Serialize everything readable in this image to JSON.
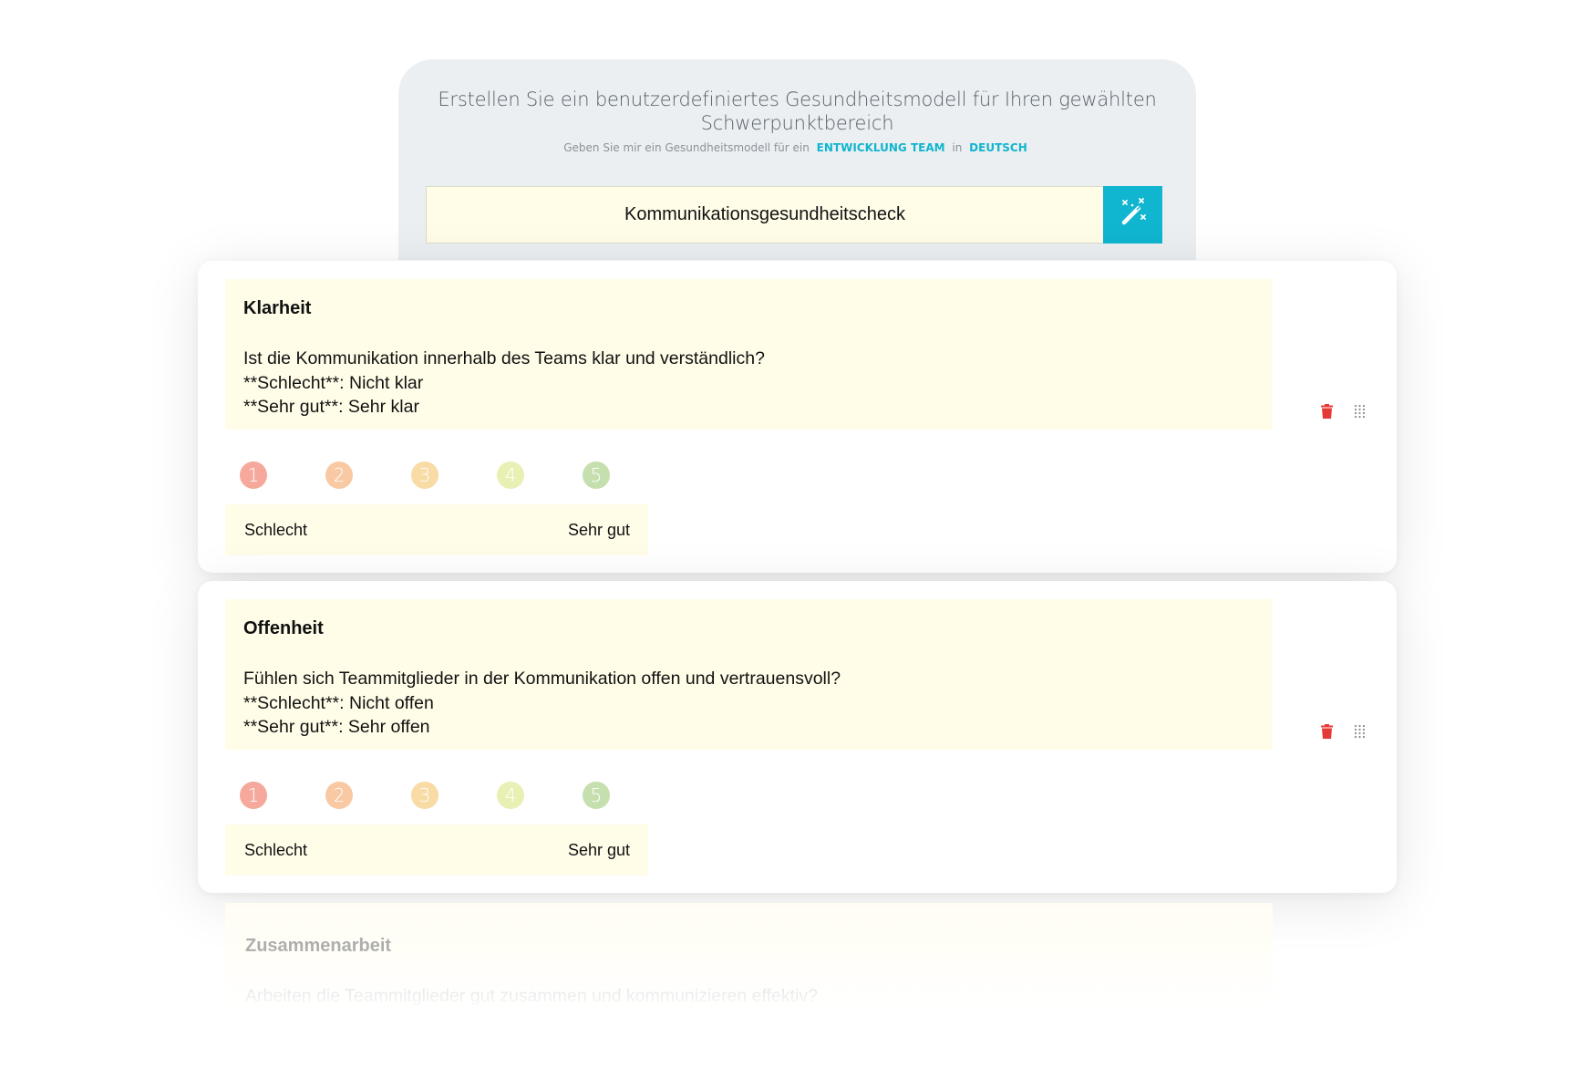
{
  "generator": {
    "title_line1": "Erstellen Sie ein benutzerdefiniertes Gesundheitsmodell für Ihren gewählten",
    "title_line2": "Schwerpunktbereich",
    "subtitle_prefix": "Geben Sie mir ein Gesundheitsmodell für ein",
    "focus_select": "ENTWICKLUNG TEAM",
    "connector": "in",
    "language_select": "DEUTSCH",
    "input_value": "Kommunikationsgesundheitscheck",
    "generate_icon": "magic-wand-icon",
    "accent_color": "#10b5cf"
  },
  "questions": [
    {
      "title": "Klarheit",
      "question": "Ist die Kommunikation innerhalb des Teams klar und verständlich?",
      "bad_line": "**Schlecht**: Nicht klar",
      "good_line": "**Sehr gut**: Sehr klar",
      "scale": [
        "1",
        "2",
        "3",
        "4",
        "5"
      ],
      "low_label": "Schlecht",
      "high_label": "Sehr gut"
    },
    {
      "title": "Offenheit",
      "question": "Fühlen sich Teammitglieder in der Kommunikation offen und vertrauensvoll?",
      "bad_line": "**Schlecht**: Nicht offen",
      "good_line": "**Sehr gut**: Sehr offen",
      "scale": [
        "1",
        "2",
        "3",
        "4",
        "5"
      ],
      "low_label": "Schlecht",
      "high_label": "Sehr gut"
    },
    {
      "title": "Zusammenarbeit",
      "question": "Arbeiten die Teammitglieder gut zusammen und kommunizieren effektiv?"
    }
  ],
  "scale_colors": [
    "#f5a89b",
    "#f8c9a3",
    "#f8dba5",
    "#e9f0b3",
    "#c6dfae"
  ],
  "action_icons": {
    "delete": "trash-icon",
    "drag": "drag-handle-icon",
    "delete_color": "#e53935"
  }
}
